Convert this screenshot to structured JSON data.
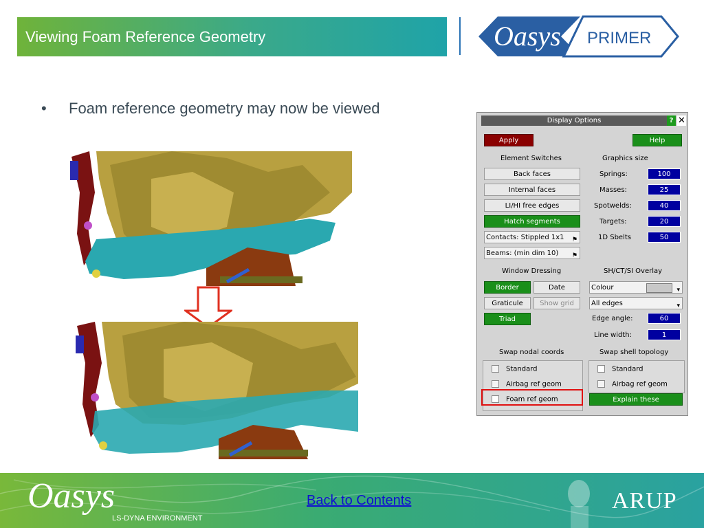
{
  "header": {
    "title": "Viewing Foam Reference Geometry",
    "logo_left": "Oasys",
    "logo_right": "PRIMER"
  },
  "bullet": {
    "dot": "•",
    "text": "Foam reference geometry may now be viewed"
  },
  "dialog": {
    "title": "Display Options",
    "help_q": "?",
    "close": "✕",
    "apply": "Apply",
    "help": "Help",
    "element_switches": "Element Switches",
    "graphics_size": "Graphics size",
    "back_faces": "Back faces",
    "internal_faces": "Internal faces",
    "li_hi_free_edges": "LI/HI free edges",
    "hatch_segments": "Hatch segments",
    "contacts": "Contacts: Stippled 1x1",
    "beams": "Beams: (min dim 10)",
    "springs_label": "Springs:",
    "springs_value": "100",
    "masses_label": "Masses:",
    "masses_value": "25",
    "spotwelds_label": "Spotwelds:",
    "spotwelds_value": "40",
    "targets_label": "Targets:",
    "targets_value": "20",
    "sbelts_label": "1D Sbelts",
    "sbelts_value": "50",
    "window_dressing": "Window Dressing",
    "overlay": "SH/CT/SI Overlay",
    "border": "Border",
    "date": "Date",
    "graticule": "Graticule",
    "show_grid": "Show grid",
    "triad": "Triad",
    "colour": "Colour",
    "all_edges": "All edges",
    "edge_angle_label": "Edge angle:",
    "edge_angle_value": "60",
    "line_width_label": "Line width:",
    "line_width_value": "1",
    "swap_nodal": "Swap nodal coords",
    "swap_shell": "Swap shell topology",
    "nodal_options": [
      "Standard",
      "Airbag ref geom",
      "Foam ref geom"
    ],
    "shell_options": [
      "Standard",
      "Airbag ref geom"
    ],
    "explain": "Explain these"
  },
  "footer": {
    "logo": "Oasys",
    "subtitle": "LS-DYNA ENVIRONMENT",
    "link": "Back to Contents",
    "brand": "ARUP"
  }
}
